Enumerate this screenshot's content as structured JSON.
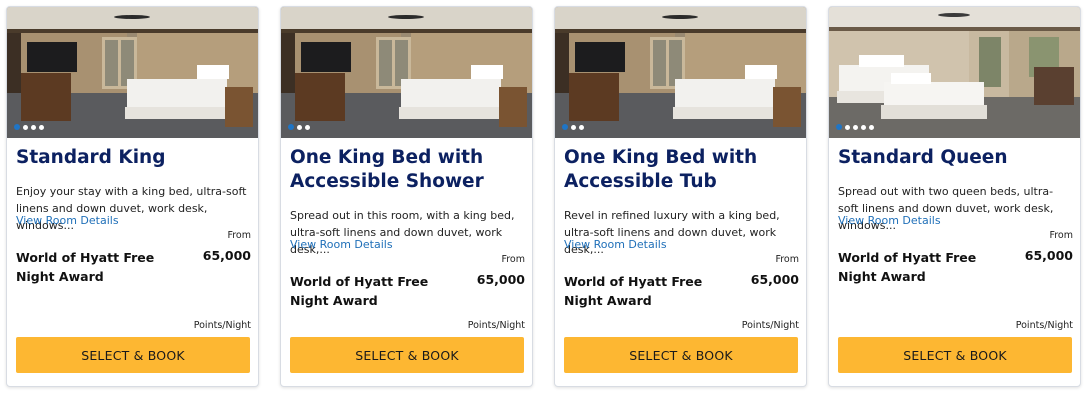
{
  "colors": {
    "title_navy": "#0c2161",
    "link_blue": "#1f6fb8",
    "button_gold": "#fdb732",
    "dot_active": "#1f75c6"
  },
  "rooms": [
    {
      "title": "Standard King",
      "description": "Enjoy your stay with a king bed, ultra-soft linens and down duvet, work desk, windows...",
      "details_link": "View Room Details",
      "award_name": "World of Hyatt Free Night Award",
      "from_label": "From",
      "points": "65,000",
      "points_unit": "Points/Night",
      "button_label": "SELECT & BOOK",
      "carousel_dots": 4,
      "photo": "king-room"
    },
    {
      "title": "One King Bed with Accessible Shower",
      "description": "Spread out in this room, with a king bed, ultra-soft linens and down duvet, work desk,...",
      "details_link": "View Room Details",
      "award_name": "World of Hyatt Free Night Award",
      "from_label": "From",
      "points": "65,000",
      "points_unit": "Points/Night",
      "button_label": "SELECT & BOOK",
      "carousel_dots": 3,
      "photo": "king-room"
    },
    {
      "title": "One King Bed with Accessible Tub",
      "description": "Revel in refined luxury with a king bed, ultra-soft linens and down duvet, work desk,...",
      "details_link": "View Room Details",
      "award_name": "World of Hyatt Free Night Award",
      "from_label": "From",
      "points": "65,000",
      "points_unit": "Points/Night",
      "button_label": "SELECT & BOOK",
      "carousel_dots": 3,
      "photo": "king-room"
    },
    {
      "title": "Standard Queen",
      "description": "Spread out with two queen beds, ultra-soft linens and down duvet, work desk, windows...",
      "details_link": "View Room Details",
      "award_name": "World of Hyatt Free Night Award",
      "from_label": "From",
      "points": "65,000",
      "points_unit": "Points/Night",
      "button_label": "SELECT & BOOK",
      "carousel_dots": 5,
      "photo": "queen-room"
    }
  ]
}
